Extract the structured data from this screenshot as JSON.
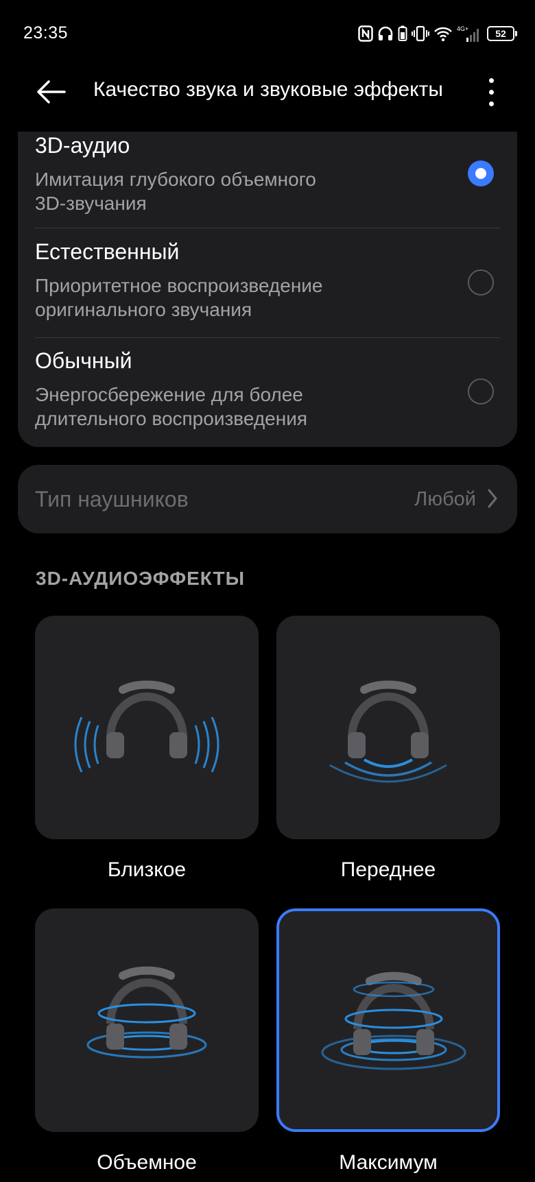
{
  "status": {
    "time": "23:35",
    "battery": "52",
    "network": "4G+"
  },
  "header": {
    "title": "Качество звука и звуковые эффекты"
  },
  "modes": [
    {
      "title": "3D-аудио",
      "desc_line1": "Имитация глубокого объемного",
      "desc_line2": "3D-звучания",
      "selected": true
    },
    {
      "title": "Естественный",
      "desc_line1": "Приоритетное воспроизведение",
      "desc_line2": "оригинального звучания",
      "selected": false
    },
    {
      "title": "Обычный",
      "desc_line1": "Энергосбережение для более",
      "desc_line2": "длительного воспроизведения",
      "selected": false
    }
  ],
  "headphone_type": {
    "label": "Тип наушников",
    "value": "Любой"
  },
  "effects_section": {
    "heading": "3D-АУДИОЭФФЕКТЫ"
  },
  "effects": [
    {
      "label": "Близкое",
      "icon": "headphones-near-icon",
      "selected": false
    },
    {
      "label": "Переднее",
      "icon": "headphones-front-icon",
      "selected": false
    },
    {
      "label": "Объемное",
      "icon": "headphones-surround-icon",
      "selected": false
    },
    {
      "label": "Максимум",
      "icon": "headphones-max-icon",
      "selected": true
    }
  ],
  "colors": {
    "accent": "#3b7bff",
    "card": "#1e1e21",
    "wave": "#2a8fe0"
  }
}
